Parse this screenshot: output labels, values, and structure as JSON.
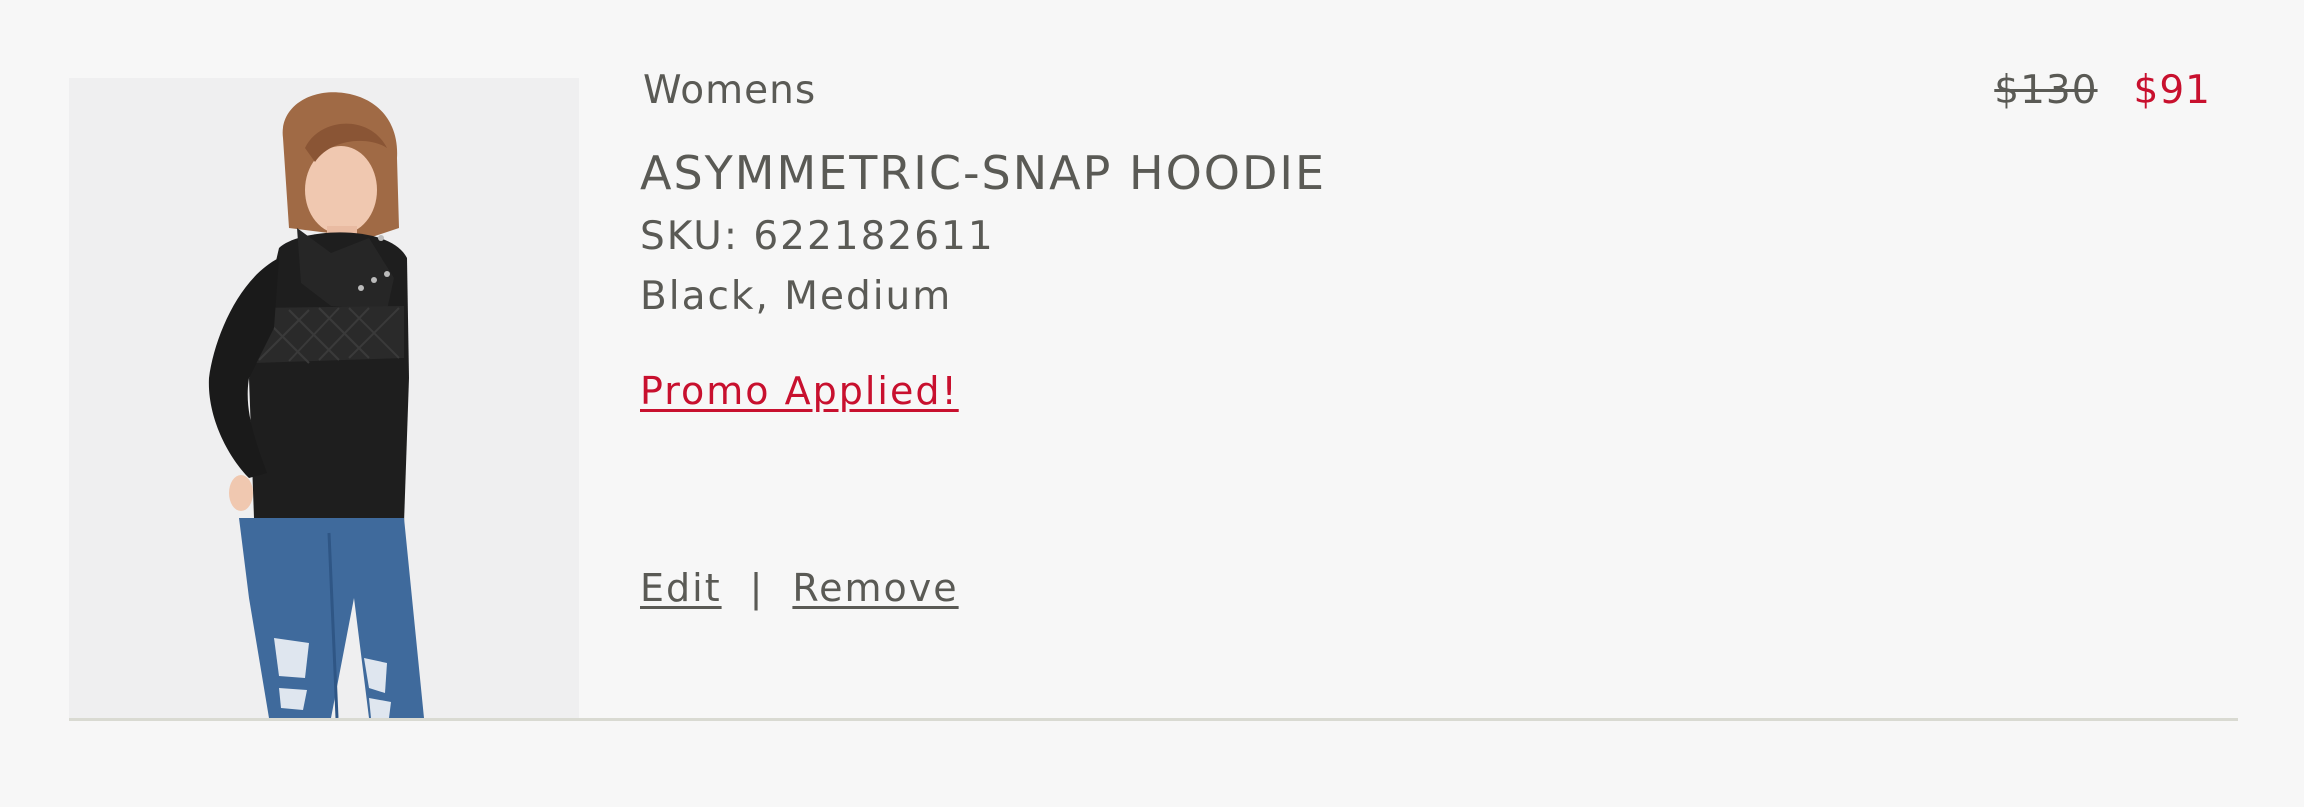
{
  "item": {
    "category": "Womens",
    "name": "ASYMMETRIC-SNAP HOODIE",
    "sku": "SKU: 622182611",
    "variant": "Black, Medium",
    "promo": "Promo Applied!",
    "price_original": "$130",
    "price_sale": "$91",
    "actions": {
      "edit": "Edit",
      "separator": "|",
      "remove": "Remove"
    },
    "image": {
      "description_icon": "product-photo",
      "colors": {
        "background": "#efeff0",
        "garment": "#1e1e1e",
        "denim": "#3f6a9c",
        "hair": "#a06a45",
        "skin": "#f0c8b0"
      }
    }
  },
  "colors": {
    "page_background": "#f7f7f7",
    "text": "#5a5a55",
    "accent_red": "#c8102e",
    "divider": "#d9dad2"
  }
}
